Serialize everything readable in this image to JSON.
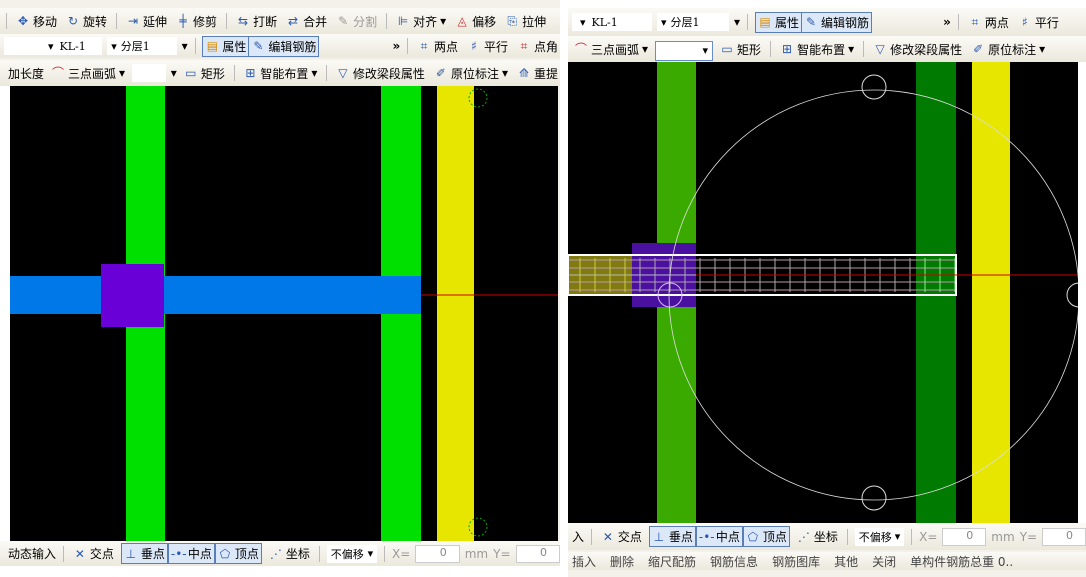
{
  "left": {
    "toolbar1": [
      "移动",
      "旋转",
      "延伸",
      "修剪",
      "打断",
      "合并",
      "分割",
      "对齐",
      "偏移",
      "拉伸"
    ],
    "toolbar2": {
      "component": "KL-1",
      "layer": "分层1",
      "property": "属性",
      "edit_rebar": "编辑钢筋",
      "more": "»",
      "two_point": "两点",
      "parallel": "平行",
      "point_angle": "点角"
    },
    "toolbar3": {
      "add_length": "加长度",
      "arc": "三点画弧",
      "combo": "",
      "rect": "矩形",
      "smart": "智能布置",
      "modify_beam": "修改梁段属性",
      "in_situ": "原位标注",
      "redo": "重提"
    },
    "status": {
      "dynamic_input": "动态输入",
      "intersection": "交点",
      "perpendicular": "垂点",
      "midpoint": "中点",
      "vertex": "顶点",
      "coordinate": "坐标",
      "offset": "不偏移",
      "x_label": "X=",
      "x": "0",
      "unit": "mm",
      "y_label": "Y=",
      "y": "0"
    }
  },
  "right": {
    "toolbar2": {
      "component": "KL-1",
      "layer": "分层1",
      "property": "属性",
      "edit_rebar": "编辑钢筋",
      "more": "»",
      "two_point": "两点",
      "parallel": "平行"
    },
    "toolbar3": {
      "arc": "三点画弧",
      "combo": "",
      "rect": "矩形",
      "smart": "智能布置",
      "modify_beam": "修改梁段属性",
      "in_situ": "原位标注"
    },
    "status": {
      "input": "入",
      "intersection": "交点",
      "perpendicular": "垂点",
      "midpoint": "中点",
      "vertex": "顶点",
      "coordinate": "坐标",
      "offset": "不偏移",
      "x_label": "X=",
      "x": "0",
      "unit": "mm",
      "y_label": "Y=",
      "y": "0"
    },
    "bottom": [
      "插入",
      "删除",
      "缩尺配筋",
      "钢筋信息",
      "钢筋图库",
      "其他",
      "关闭",
      "单构件钢筋总重 0.."
    ]
  },
  "colors": {
    "column": "#00e000",
    "column_dark": "#007a00",
    "column_mid": "#3aaa00",
    "beam": "#0078e8",
    "column_selected": "#6a00d8",
    "wall": "#e6e600",
    "axis": "#d00000"
  }
}
